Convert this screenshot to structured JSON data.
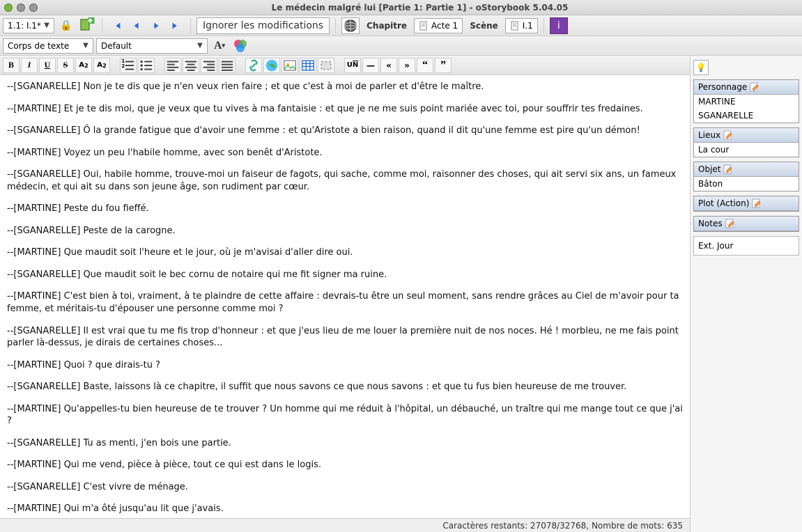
{
  "window": {
    "title": "Le médecin malgré lui [Partie 1: Partie 1] - oStorybook 5.04.05"
  },
  "toolbar1": {
    "scene_combo": "1.1: I.1*",
    "ignore_button": "Ignorer les modifications",
    "chapitre_label": "Chapitre",
    "acte_label": "Acte 1",
    "scene_label": "Scène",
    "scene_chip": "I.1"
  },
  "toolbar2": {
    "style_combo": "Corps de texte",
    "font_combo": "Default"
  },
  "format_icons": {
    "bold": "B",
    "italic": "I",
    "underline": "U",
    "strike": "S",
    "sub": "A₂",
    "sup": "A²",
    "ol": "≡",
    "ul": "≡",
    "left": "≡",
    "center": "≡",
    "right": "≡",
    "justify": "≡",
    "link": "🔗",
    "img": "🌐",
    "pic": "🖼",
    "table": "▦",
    "obj": "▢",
    "un": "UN",
    "hr": "—",
    "rew": "«",
    "fwd": "»",
    "lq": "“",
    "rq": "”"
  },
  "paragraphs": [
    "--[SGANARELLE] Non je te dis que je n'en veux rien faire ; et que c'est à moi de parler et d'être le maître.",
    "--[MARTINE] Et je te dis moi, que je veux que tu vives à ma fantaisie : et que je ne me suis point mariée avec toi, pour souffrir tes fredaines.",
    "--[SGANARELLE] Ô la grande fatigue que d'avoir une femme : et qu'Aristote a bien raison, quand il dit qu'une femme est pire qu'un démon!",
    "--[MARTINE] Voyez un peu l'habile homme, avec son benêt d'Aristote.",
    "--[SGANARELLE] Oui, habile homme, trouve-moi un faiseur de fagots, qui sache, comme moi, raisonner des choses, qui ait servi six ans, un fameux médecin, et qui ait su dans son jeune âge, son rudiment par cœur.",
    "--[MARTINE] Peste du fou fieffé.",
    "--[SGANARELLE] Peste de la carogne.",
    "--[MARTINE] Que maudit soit l'heure et le jour, où je m'avisai d'aller dire oui.",
    "--[SGANARELLE] Que maudit soit le bec cornu de notaire qui me fit signer ma ruine.",
    "--[MARTINE] C'est bien à toi, vraiment, à te plaindre de cette affaire : devrais-tu être un seul moment, sans rendre grâces au Ciel de m'avoir pour ta femme, et méritais-tu d'épouser une personne comme moi ?",
    "--[SGANARELLE] Il est vrai que tu me fis trop d'honneur : et que j'eus lieu de me louer la première nuit de nos noces. Hé ! morbleu, ne me fais point parler là-dessus, je dirais de certaines choses...",
    "--[MARTINE] Quoi ? que dirais-tu ?",
    "--[SGANARELLE] Baste, laissons là ce chapitre, il suffit que nous savons ce que nous savons : et que tu fus bien heureuse de me trouver.",
    "--[MARTINE] Qu'appelles-tu bien heureuse de te trouver ? Un homme qui me réduit à l'hôpital, un débauché, un traître qui me mange tout ce que j'ai ?",
    "--[SGANARELLE] Tu as menti, j'en bois une partie.",
    "--[MARTINE] Qui me vend, pièce à pièce, tout ce qui est dans le logis.",
    "--[SGANARELLE] C'est vivre de ménage.",
    "--[MARTINE] Qui m'a ôté jusqu'au lit que j'avais."
  ],
  "status": "Caractères restants: 27078/32768, Nombre de mots: 635",
  "side": {
    "personnage_hdr": "Personnage",
    "personnages": [
      "MARTINE",
      "SGANARELLE"
    ],
    "lieux_hdr": "Lieux",
    "lieux": [
      "La cour"
    ],
    "objet_hdr": "Objet",
    "objets": [
      "Bâton"
    ],
    "plot_hdr": "Plot (Action)",
    "notes_hdr": "Notes",
    "ext": "Ext. Jour"
  }
}
